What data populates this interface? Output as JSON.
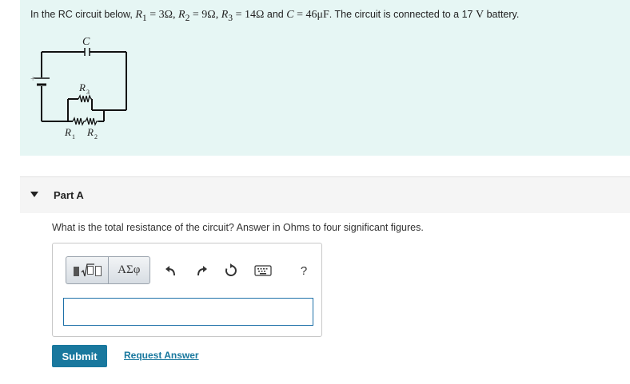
{
  "problem": {
    "text_prefix": "In the RC circuit below, ",
    "r1_sym": "R",
    "r1_sub": "1",
    "r1_val": " = 3Ω, ",
    "r2_sym": "R",
    "r2_sub": "2",
    "r2_val": " = 9Ω, ",
    "r3_sym": "R",
    "r3_sub": "3",
    "r3_val": " = 14Ω",
    "and": " and ",
    "c_sym": "C",
    "c_val": " = 46μF",
    "text_mid": ". The circuit is connected to a 17 ",
    "volt_unit": "V",
    "text_suffix": " battery."
  },
  "circuit": {
    "capacitor_label": "C",
    "r3_label": "R",
    "r3_sub": "3",
    "r1_label": "R",
    "r1_sub": "1",
    "r2_label": "R",
    "r2_sub": "2",
    "battery_plus": "+"
  },
  "part": {
    "title": "Part A",
    "question": "What is the total resistance of the circuit? Answer in Ohms to four significant figures."
  },
  "toolbar": {
    "symbols_label": "ΑΣφ",
    "help_label": "?"
  },
  "answer": {
    "value": ""
  },
  "actions": {
    "submit_label": "Submit",
    "request_label": "Request Answer"
  }
}
